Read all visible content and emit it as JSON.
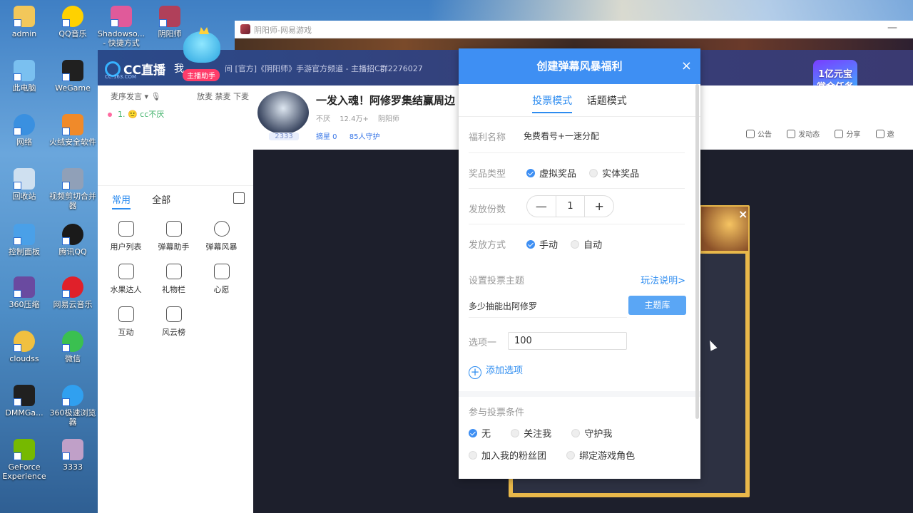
{
  "desktop": {
    "icons": [
      "admin",
      "QQ音乐",
      "Shadowso... - 快捷方式",
      "阴阳师",
      "此电脑",
      "WeGame",
      "网络",
      "火绒安全软件",
      "回收站",
      "视频剪切合并器",
      "控制面板",
      "腾讯QQ",
      "360压缩",
      "网易云音乐",
      "cloudss",
      "微信",
      "DMMGa...",
      "360极速浏览器",
      "GeForce Experience",
      "3333"
    ]
  },
  "window": {
    "title": "阴阳师-网易游戏",
    "minimize": "—"
  },
  "cc": {
    "logo": "CC直播",
    "logo_sub": "CC.163.COM",
    "my_label": "我",
    "anchor_badge": "主播助手",
    "room_info": "间 [官方]《阴阳师》手游官方频道 - 主播招C群2276027",
    "promo": {
      "line1": "1亿元宝",
      "line2": "赏金任务"
    },
    "left": {
      "head_left": "麦序发言",
      "head_right": "放麦 禁麦 下麦",
      "chat_line": "1. 🙂 cc不厌",
      "tabs": [
        "常用",
        "全部"
      ],
      "tools": [
        "用户列表",
        "弹幕助手",
        "弹幕风暴",
        "水果达人",
        "礼物栏",
        "心愿",
        "互动",
        "风云榜"
      ]
    },
    "streamer": {
      "title": "一发入魂！阿修罗集结赢周边",
      "room_num": "2333",
      "stats": [
        "不厌",
        "12.4万+",
        "阴阳师"
      ],
      "badges": [
        "摘星 0",
        "85人守护"
      ]
    },
    "header_actions": [
      "公告",
      "发动态",
      "分享",
      "邀"
    ]
  },
  "dialog": {
    "title": "创建弹幕风暴福利",
    "close": "×",
    "tabs": [
      "投票模式",
      "话题模式"
    ],
    "welfare_name_label": "福利名称",
    "welfare_name_value": "免费看号+一速分配",
    "prize_type_label": "奖品类型",
    "prize_virtual": "虚拟奖品",
    "prize_physical": "实体奖品",
    "count_label": "发放份数",
    "count_minus": "—",
    "count_value": "1",
    "count_plus": "+",
    "method_label": "发放方式",
    "method_manual": "手动",
    "method_auto": "自动",
    "theme_label": "设置投票主题",
    "rules_link": "玩法说明>",
    "theme_text": "多少抽能出阿修罗",
    "theme_lib_button": "主题库",
    "option1_label": "选项一",
    "option1_value": "100",
    "add_option": "添加选项",
    "conditions_label": "参与投票条件",
    "cond_none": "无",
    "cond_follow": "关注我",
    "cond_guard": "守护我",
    "cond_fans": "加入我的粉丝团",
    "cond_bind": "绑定游戏角色"
  },
  "popup": {
    "close": "×"
  }
}
